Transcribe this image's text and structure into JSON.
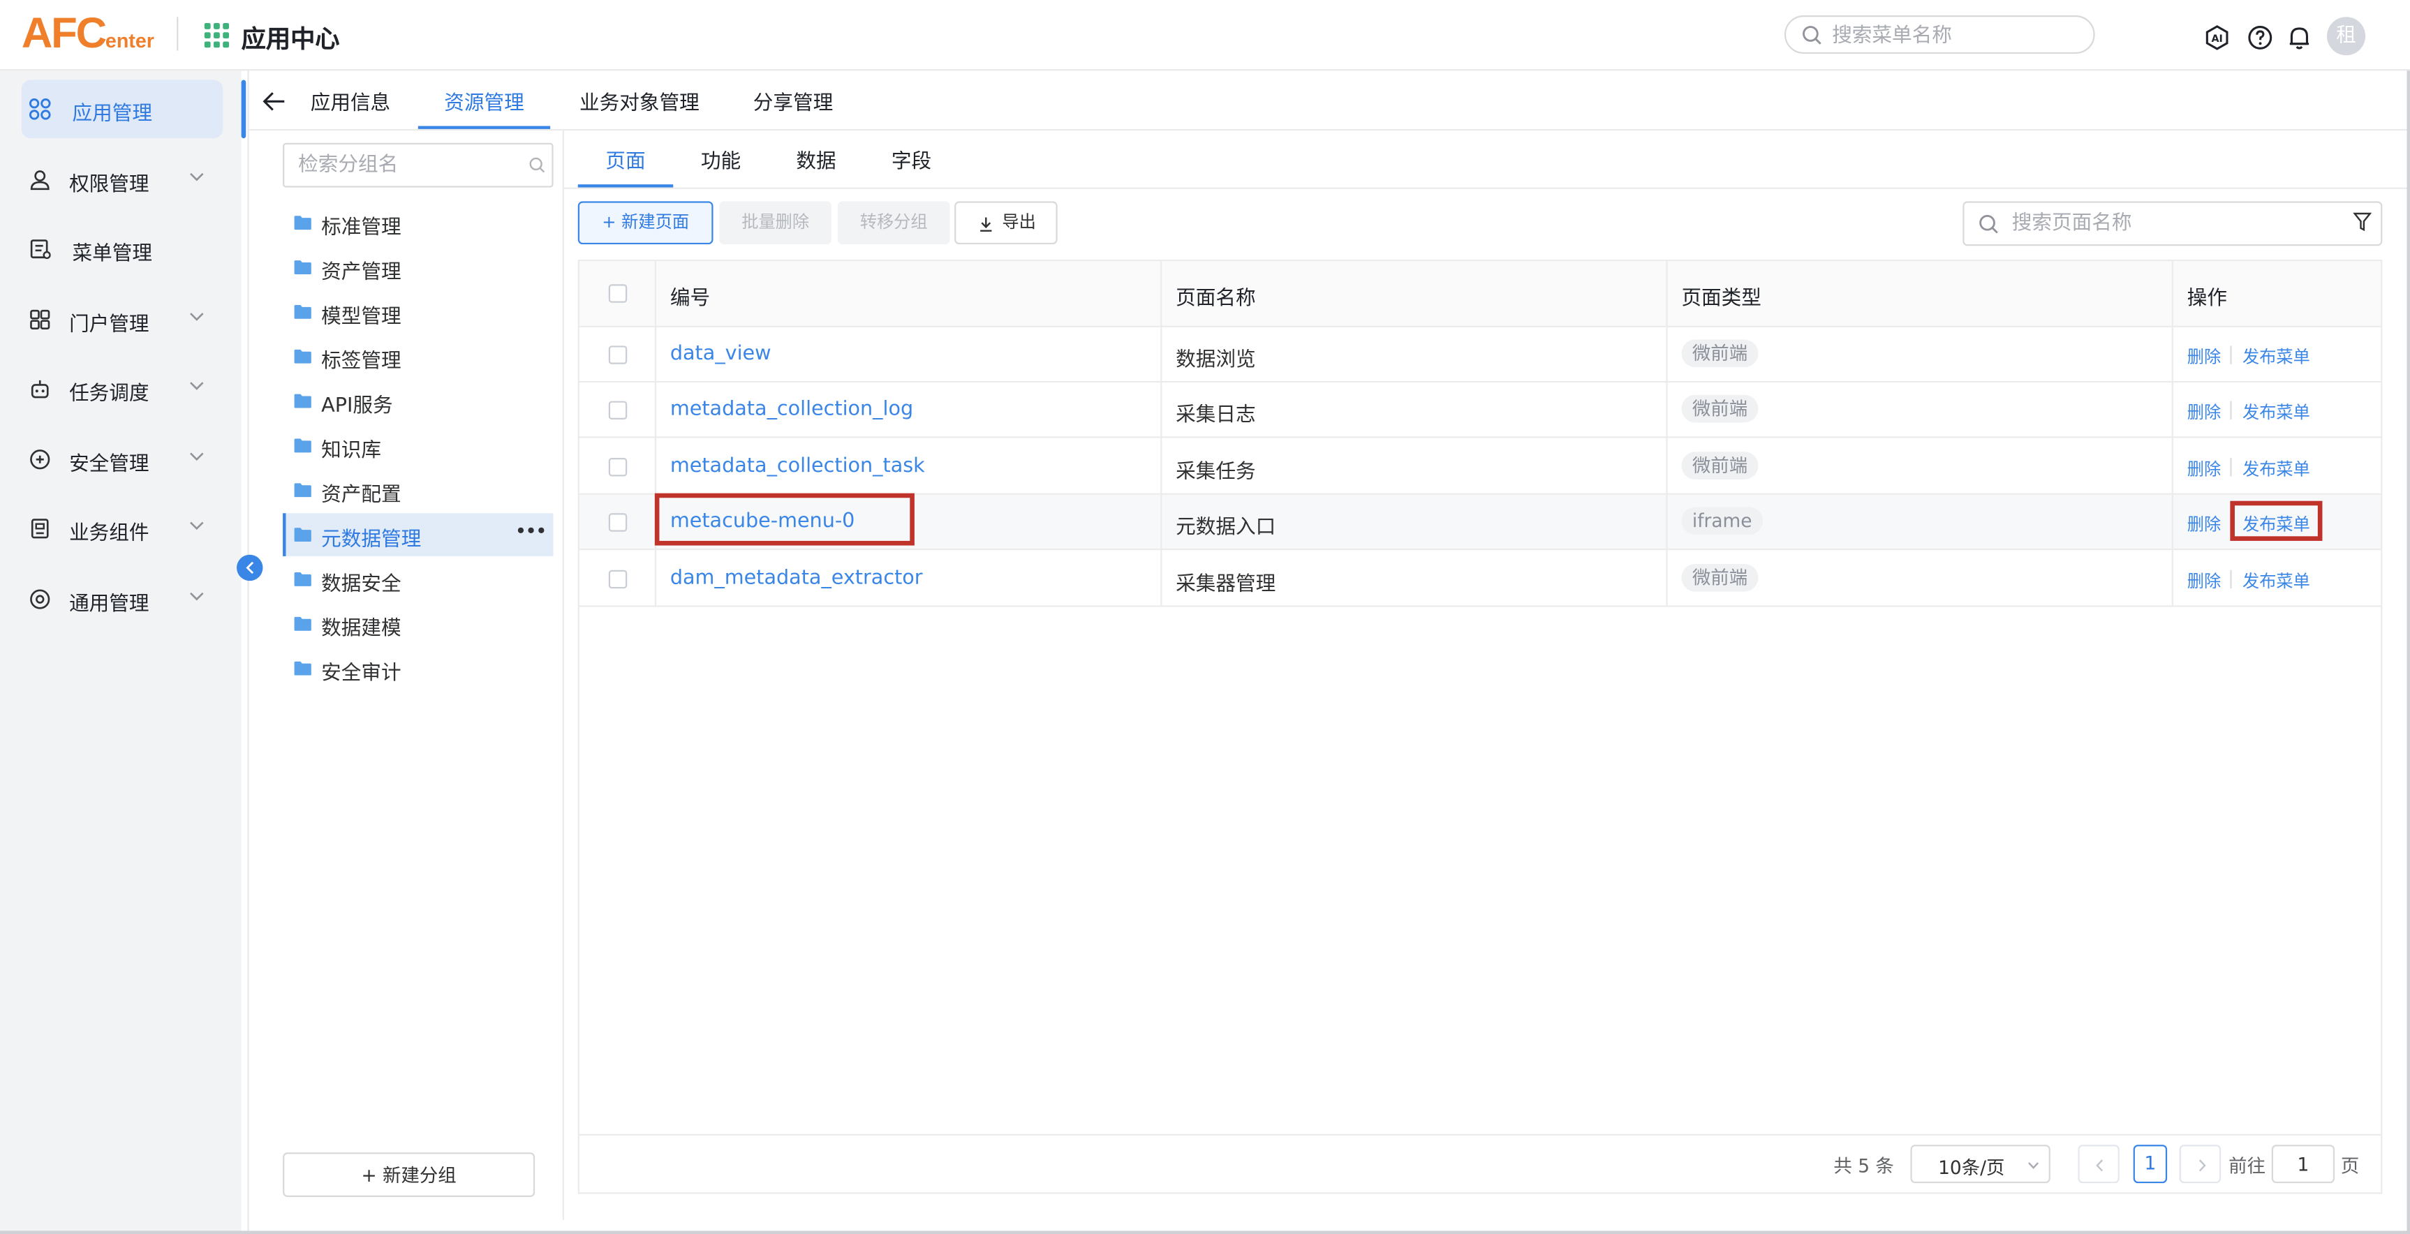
{
  "header": {
    "logo_big": "AFC",
    "logo_small": "enter",
    "app_title": "应用中心",
    "search_placeholder": "搜索菜单名称",
    "avatar_text": "租",
    "ai_icon": "ai-icon",
    "help_icon": "help-icon",
    "bell_icon": "bell-icon"
  },
  "leftnav": {
    "items": [
      {
        "label": "应用管理",
        "icon": "apps-icon",
        "active": true,
        "chevron": false
      },
      {
        "label": "权限管理",
        "icon": "user-icon",
        "chevron": true
      },
      {
        "label": "菜单管理",
        "icon": "menu-icon",
        "chevron": false
      },
      {
        "label": "门户管理",
        "icon": "portal-icon",
        "chevron": true
      },
      {
        "label": "任务调度",
        "icon": "robot-icon",
        "chevron": true
      },
      {
        "label": "安全管理",
        "icon": "shield-icon",
        "chevron": true
      },
      {
        "label": "业务组件",
        "icon": "component-icon",
        "chevron": true
      },
      {
        "label": "通用管理",
        "icon": "settings-icon",
        "chevron": true
      }
    ]
  },
  "top_tabs": [
    "应用信息",
    "资源管理",
    "业务对象管理",
    "分享管理"
  ],
  "top_tab_active": "资源管理",
  "groups": {
    "search_placeholder": "检索分组名",
    "items": [
      "标准管理",
      "资产管理",
      "模型管理",
      "标签管理",
      "API服务",
      "知识库",
      "资产配置",
      "元数据管理",
      "数据安全",
      "数据建模",
      "安全审计"
    ],
    "active": "元数据管理",
    "more": "•••",
    "new_group": "+ 新建分组"
  },
  "sub_tabs": [
    "页面",
    "功能",
    "数据",
    "字段"
  ],
  "sub_tab_active": "页面",
  "toolbar": {
    "new_page": "+ 新建页面",
    "batch_delete": "批量删除",
    "move_group": "转移分组",
    "export": "导出",
    "search_placeholder": "搜索页面名称"
  },
  "table": {
    "headers": [
      "编号",
      "页面名称",
      "页面类型",
      "操作"
    ],
    "rows": [
      {
        "code": "data_view",
        "name": "数据浏览",
        "type": "微前端"
      },
      {
        "code": "metadata_collection_log",
        "name": "采集日志",
        "type": "微前端"
      },
      {
        "code": "metadata_collection_task",
        "name": "采集任务",
        "type": "微前端"
      },
      {
        "code": "metacube-menu-0",
        "name": "元数据入口",
        "type": "iframe"
      },
      {
        "code": "dam_metadata_extractor",
        "name": "采集器管理",
        "type": "微前端"
      }
    ],
    "op_delete": "删除",
    "op_publish": "发布菜单"
  },
  "pagination": {
    "total": "共 5 条",
    "page_size": "10条/页",
    "current": "1",
    "goto_label": "前往",
    "goto_value": "1",
    "page_unit": "页"
  }
}
